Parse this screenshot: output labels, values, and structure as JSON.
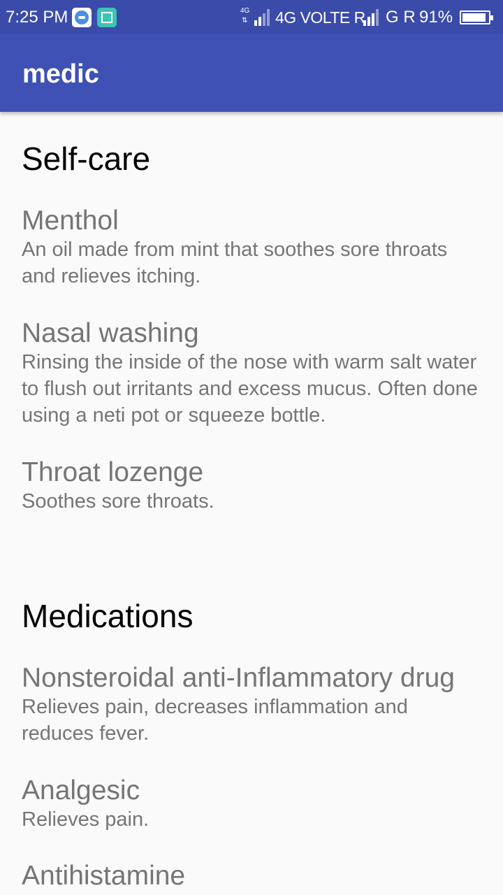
{
  "status_bar": {
    "time": "7:25 PM",
    "network_small": "4G",
    "network_text": "4G VOLTE R",
    "network2_text": "G R",
    "battery": "91%",
    "battery_level": 0.91,
    "icons": [
      "app-notification-icon",
      "screenshot-icon",
      "signal-icon",
      "battery-icon"
    ]
  },
  "app_bar": {
    "title": "medic",
    "color": "#3f51b5"
  },
  "sections": [
    {
      "heading": "Self-care",
      "items": [
        {
          "title": "Menthol",
          "description": "An oil made from mint that soothes sore throats and relieves itching."
        },
        {
          "title": "Nasal washing",
          "description": "Rinsing the inside of the nose with warm salt water to flush out irritants and excess mucus. Often done using a neti pot or squeeze bottle."
        },
        {
          "title": "Throat lozenge",
          "description": "Soothes sore throats."
        }
      ]
    },
    {
      "heading": "Medications",
      "items": [
        {
          "title": "Nonsteroidal anti-Inflammatory drug",
          "description": "Relieves pain, decreases inflammation and reduces fever."
        },
        {
          "title": "Analgesic",
          "description": "Relieves pain."
        },
        {
          "title": "Antihistamine",
          "description": ""
        }
      ]
    }
  ]
}
